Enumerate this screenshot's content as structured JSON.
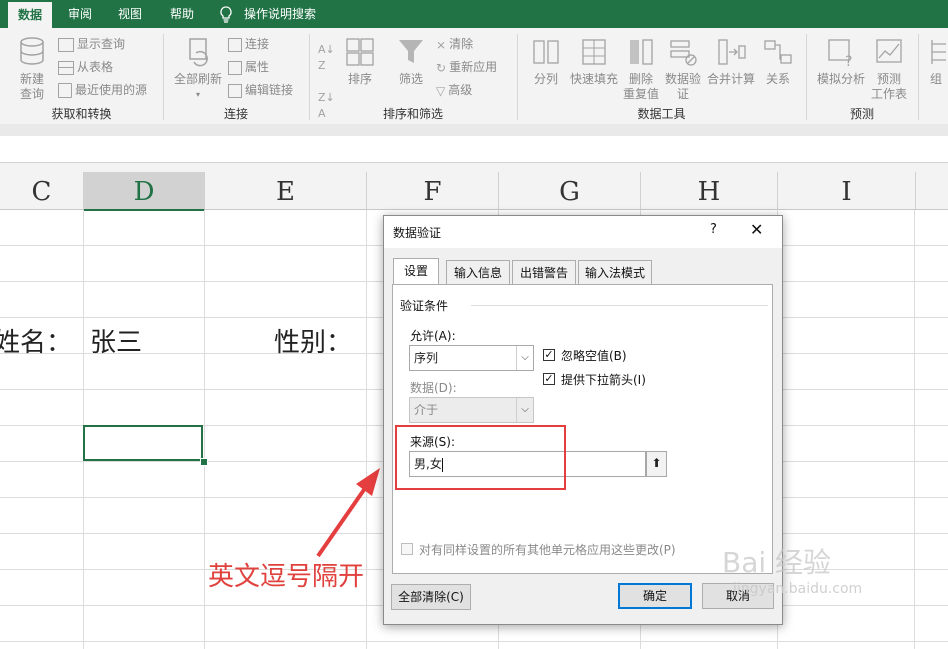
{
  "ribbon": {
    "tabs": [
      {
        "label": "数据",
        "active": true
      },
      {
        "label": "审阅",
        "active": false
      },
      {
        "label": "视图",
        "active": false
      },
      {
        "label": "帮助",
        "active": false
      }
    ],
    "search_label": "操作说明搜索",
    "groups": {
      "get_transform": {
        "label": "获取和转换",
        "new_query": "新建\n查询",
        "show_queries": "显示查询",
        "from_table": "从表格",
        "recent_sources": "最近使用的源"
      },
      "connections": {
        "label": "连接",
        "refresh_all": "全部刷新",
        "connections": "连接",
        "properties": "属性",
        "edit_links": "编辑链接"
      },
      "sort_filter": {
        "label": "排序和筛选",
        "sort": "排序",
        "filter": "筛选",
        "clear": "清除",
        "reapply": "重新应用",
        "advanced": "高级"
      },
      "data_tools": {
        "label": "数据工具",
        "text_to_columns": "分列",
        "flash_fill": "快速填充",
        "remove_duplicates": "删除\n重复值",
        "data_validation": "数据验\n证",
        "consolidate": "合并计算",
        "relationships": "关系"
      },
      "forecast": {
        "label": "预测",
        "what_if": "模拟分析",
        "forecast_sheet": "预测\n工作表"
      },
      "outline_partial": "组"
    }
  },
  "sheet": {
    "columns": [
      {
        "letter": "C",
        "selected": false
      },
      {
        "letter": "D",
        "selected": true
      },
      {
        "letter": "E",
        "selected": false
      },
      {
        "letter": "F",
        "selected": false
      },
      {
        "letter": "G",
        "selected": false
      },
      {
        "letter": "H",
        "selected": false
      },
      {
        "letter": "I",
        "selected": false
      }
    ],
    "cells": {
      "name_label": "姓名：",
      "name_value": "张三",
      "gender_label": "性别："
    }
  },
  "annotation": "英文逗号隔开",
  "dialog": {
    "title": "数据验证",
    "help": "?",
    "close": "✕",
    "tabs": [
      {
        "label": "设置",
        "active": true
      },
      {
        "label": "输入信息",
        "active": false
      },
      {
        "label": "出错警告",
        "active": false
      },
      {
        "label": "输入法模式",
        "active": false
      }
    ],
    "section_title": "验证条件",
    "allow_label": "允许(A):",
    "allow_value": "序列",
    "ignore_blank": "忽略空值(B)",
    "ignore_blank_checked": true,
    "in_cell_dropdown": "提供下拉箭头(I)",
    "in_cell_dropdown_checked": true,
    "data_label": "数据(D):",
    "data_value": "介于",
    "source_label": "来源(S):",
    "source_value": "男,女",
    "apply_all": "对有同样设置的所有其他单元格应用这些更改(P)",
    "clear_all": "全部清除(C)",
    "ok": "确定",
    "cancel": "取消"
  },
  "watermark": {
    "brand": "Bai 经验",
    "url": "jingyan.baidu.com"
  },
  "colors": {
    "excel_green": "#217346",
    "annotation_red": "#e0413d",
    "default_button_blue": "#0078d7"
  }
}
